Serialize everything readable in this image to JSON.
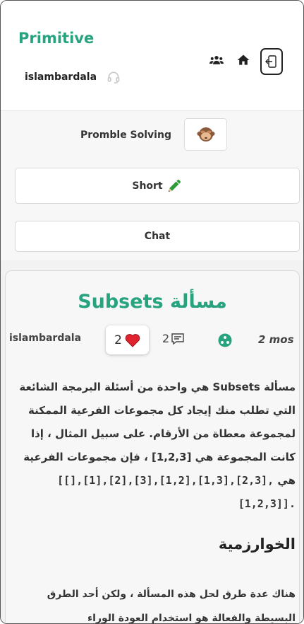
{
  "header": {
    "brand": "Primitive",
    "username": "islambardala",
    "icons": [
      "headset-icon",
      "group-icon",
      "home-icon",
      "logout-icon"
    ]
  },
  "menu": {
    "problem_label": "Promble Solving",
    "short_label": "Short",
    "chat_label": "Chat"
  },
  "article": {
    "title": "مسألة Subsets",
    "author": "islambardala",
    "likes": "2",
    "comments": "2",
    "time_ago": "2 mos",
    "paragraph_1": "مسألة Subsets هي واحدة من أسئلة البرمجة الشائعة التي تطلب منك إيجاد كل مجموعات الفرعية الممكنة لمجموعة معطاة من الأرقام. على سبيل المثال ، إذا كانت المجموعة هي [1,2,3] ، فإن مجموعات الفرعية هي",
    "subsets_code": "[[],[1],[2],[3],[1,2],[1,3],[2,3],[1,2,3]].",
    "heading": "الخوارزمية",
    "paragraph_2": "هناك عدة طرق لحل هذه المسألة ، ولكن أحد الطرق البسيطة والفعالة هو استخدام العودة الوراء"
  },
  "colors": {
    "brand": "#27a37f",
    "heart": "#e0242f",
    "pencil": "#2e9a3a"
  }
}
